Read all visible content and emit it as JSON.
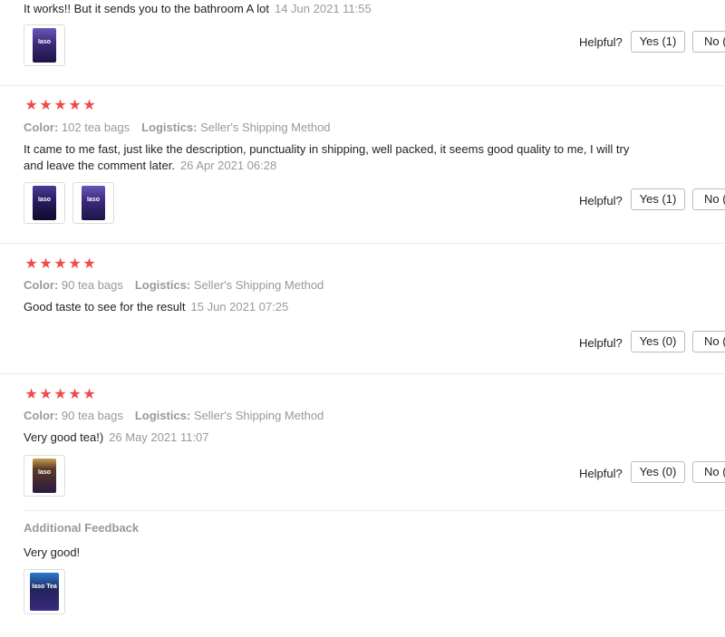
{
  "reviews": [
    {
      "text": "It works!! But it sends you to the bathroom A lot",
      "date": "14 Jun 2021 11:55",
      "helpful_label": "Helpful?",
      "yes_label": "Yes (1)",
      "no_label": "No (",
      "thumbnails": [
        "tea-package-photo"
      ]
    },
    {
      "rating": 5,
      "color_label": "Color:",
      "color_value": "102 tea bags",
      "logistics_label": "Logistics:",
      "logistics_value": "Seller's Shipping Method",
      "text_line1": "It came to me fast, just like the description, punctuality in shipping, well packed, it seems good quality to me, I will try",
      "text_line2": "and leave the comment later.",
      "date": "26 Apr 2021 06:28",
      "helpful_label": "Helpful?",
      "yes_label": "Yes (1)",
      "no_label": "No (",
      "thumbnails": [
        "tea-package-photo",
        "tea-package-photo"
      ]
    },
    {
      "rating": 5,
      "color_label": "Color:",
      "color_value": "90 tea bags",
      "logistics_label": "Logistics:",
      "logistics_value": "Seller's Shipping Method",
      "text": "Good taste to see for the result",
      "date": "15 Jun 2021 07:25",
      "helpful_label": "Helpful?",
      "yes_label": "Yes (0)",
      "no_label": "No ("
    },
    {
      "rating": 5,
      "color_label": "Color:",
      "color_value": "90 tea bags",
      "logistics_label": "Logistics:",
      "logistics_value": "Seller's Shipping Method",
      "text": "Very good tea!)",
      "date": "26 May 2021 11:07",
      "helpful_label": "Helpful?",
      "yes_label": "Yes (0)",
      "no_label": "No (",
      "thumbnails": [
        "tea-package-photo"
      ],
      "additional_feedback": {
        "title": "Additional Feedback",
        "text": "Very good!",
        "thumbnails": [
          "tea-package-photo"
        ]
      }
    }
  ],
  "colors": {
    "star": "#f04b4b",
    "muted_text": "#999999",
    "divider": "#ececec",
    "button_border": "#bbbbbb"
  },
  "icons": {
    "star": "star-icon"
  }
}
